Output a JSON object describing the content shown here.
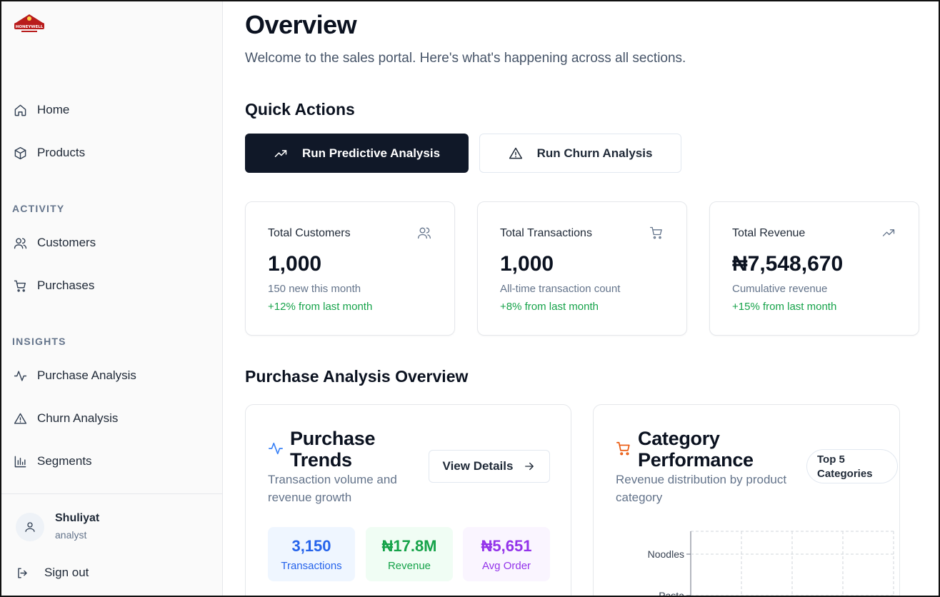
{
  "brand": {
    "logo_text": "HONEYWELL"
  },
  "sidebar": {
    "items": [
      {
        "label": "Home",
        "icon": "home-icon"
      },
      {
        "label": "Products",
        "icon": "box-icon"
      }
    ],
    "sections": [
      {
        "label": "ACTIVITY",
        "items": [
          {
            "label": "Customers",
            "icon": "users-icon"
          },
          {
            "label": "Purchases",
            "icon": "cart-icon"
          }
        ]
      },
      {
        "label": "INSIGHTS",
        "items": [
          {
            "label": "Purchase Analysis",
            "icon": "activity-icon"
          },
          {
            "label": "Churn Analysis",
            "icon": "alert-triangle-icon"
          },
          {
            "label": "Segments",
            "icon": "bar-chart-icon"
          }
        ]
      }
    ],
    "user": {
      "name": "Shuliyat",
      "role": "analyst"
    },
    "signout_label": "Sign out"
  },
  "main": {
    "title": "Overview",
    "subtitle": "Welcome to the sales portal. Here's what's happening across all sections.",
    "quick_actions": {
      "title": "Quick Actions",
      "primary_label": "Run Predictive Analysis",
      "secondary_label": "Run Churn Analysis"
    },
    "stats": [
      {
        "label": "Total Customers",
        "value": "1,000",
        "desc": "150 new this month",
        "change": "+12% from last month",
        "icon": "users-icon"
      },
      {
        "label": "Total Transactions",
        "value": "1,000",
        "desc": "All-time transaction count",
        "change": "+8% from last month",
        "icon": "cart-icon"
      },
      {
        "label": "Total Revenue",
        "value": "₦7,548,670",
        "desc": "Cumulative revenue",
        "change": "+15% from last month",
        "icon": "trending-up-icon"
      }
    ],
    "purchase_overview": {
      "title": "Purchase Analysis Overview",
      "trends": {
        "title_line1": "Purchase",
        "title_line2": "Trends",
        "subtitle_line1": "Transaction volume and",
        "subtitle_line2": "revenue growth",
        "view_label": "View Details",
        "metrics": [
          {
            "value": "3,150",
            "label": "Transactions",
            "color": "#2563eb",
            "bg": "#eff6ff"
          },
          {
            "value": "₦17.8M",
            "label": "Revenue",
            "color": "#16a34a",
            "bg": "#f0fdf4"
          },
          {
            "value": "₦5,651",
            "label": "Avg Order",
            "color": "#9333ea",
            "bg": "#faf5ff"
          }
        ]
      },
      "category": {
        "title_line1": "Category",
        "title_line2": "Performance",
        "subtitle_line1": "Revenue distribution by product",
        "subtitle_line2": "category",
        "badge_line1": "Top 5",
        "badge_line2": "Categories"
      }
    }
  },
  "chart_data": {
    "type": "bar",
    "orientation": "horizontal",
    "categories": [
      "Noodles",
      "Pasta"
    ],
    "values": [],
    "grid": true,
    "title": "",
    "xlabel": "",
    "ylabel": ""
  }
}
